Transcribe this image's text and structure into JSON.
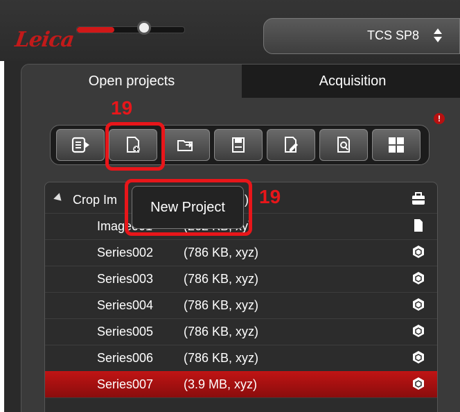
{
  "header": {
    "logo_text": "Leica",
    "microscope_select": {
      "value": "TCS SP8"
    },
    "slider_level_percent": 70
  },
  "tabs": [
    {
      "label": "Open projects",
      "active": true
    },
    {
      "label": "Acquisition",
      "active": false
    }
  ],
  "annotation_number": "19",
  "info_badge": "!",
  "toolbar": {
    "buttons": [
      {
        "icon": "menu-arrow-icon"
      },
      {
        "icon": "new-project-icon",
        "highlighted": true
      },
      {
        "icon": "open-folder-icon"
      },
      {
        "icon": "save-icon"
      },
      {
        "icon": "edit-document-icon"
      },
      {
        "icon": "find-document-icon"
      },
      {
        "icon": "grid-layout-icon"
      }
    ]
  },
  "tooltip": {
    "text": "New Project"
  },
  "tree": {
    "root": {
      "label_visible": "Crop Im",
      "label_tail": ")"
    },
    "items": [
      {
        "name": "Image001",
        "info": "(262 KB, xy)",
        "icon": "document-icon"
      },
      {
        "name": "Series002",
        "info": "(786 KB, xyz)",
        "icon": "cube-icon"
      },
      {
        "name": "Series003",
        "info": "(786 KB, xyz)",
        "icon": "cube-icon"
      },
      {
        "name": "Series004",
        "info": "(786 KB, xyz)",
        "icon": "cube-icon"
      },
      {
        "name": "Series005",
        "info": "(786 KB, xyz)",
        "icon": "cube-icon"
      },
      {
        "name": "Series006",
        "info": "(786 KB, xyz)",
        "icon": "cube-icon"
      },
      {
        "name": "Series007",
        "info": "(3.9 MB, xyz)",
        "icon": "cube-icon",
        "selected": true
      }
    ]
  },
  "colors": {
    "accent": "#e8161a",
    "selection": "#b01010"
  }
}
